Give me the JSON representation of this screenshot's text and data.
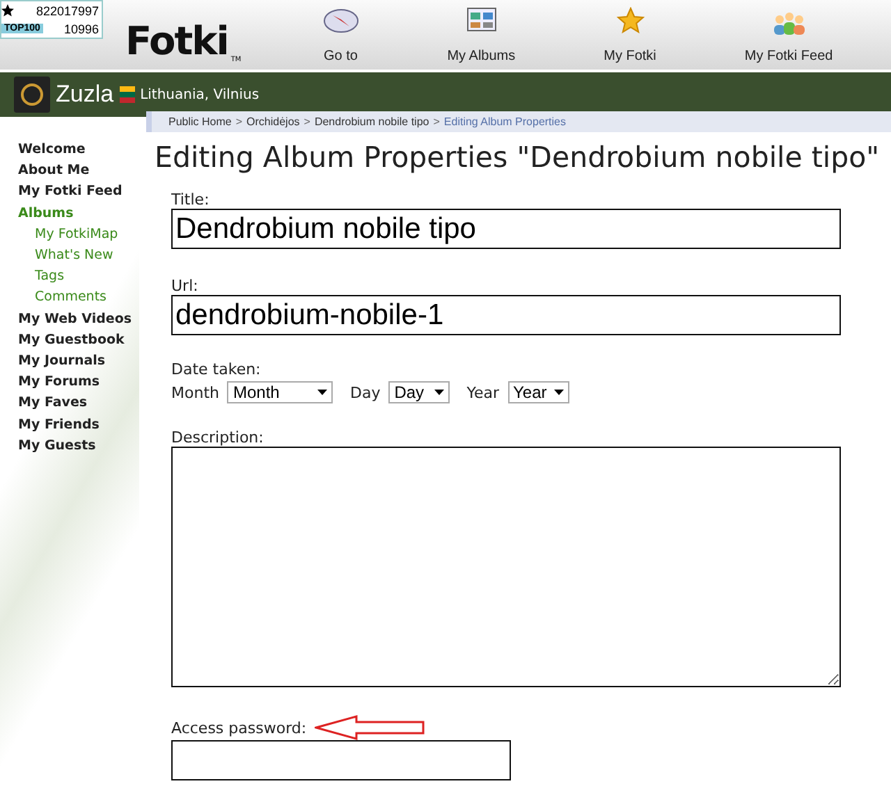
{
  "counter": {
    "hits": "822017997",
    "badge": "TOP100",
    "rank": "10996"
  },
  "logo": {
    "text": "Fotki",
    "tm": "TM"
  },
  "nav": [
    {
      "label": "Go to",
      "kind": "compass"
    },
    {
      "label": "My Albums",
      "kind": "albums"
    },
    {
      "label": "My Fotki",
      "kind": "star"
    },
    {
      "label": "My Fotki Feed",
      "kind": "people"
    }
  ],
  "user": {
    "name": "Zuzla",
    "location": "Lithuania, Vilnius"
  },
  "sidebar": [
    {
      "label": "Welcome",
      "selected": false
    },
    {
      "label": "About Me",
      "selected": false
    },
    {
      "label": "My Fotki Feed",
      "selected": false
    },
    {
      "label": "Albums",
      "selected": true,
      "children": [
        {
          "label": "My FotkiMap"
        },
        {
          "label": "What's New"
        },
        {
          "label": "Tags"
        },
        {
          "label": "Comments"
        }
      ]
    },
    {
      "label": "My Web Videos",
      "selected": false
    },
    {
      "label": "My Guestbook",
      "selected": false
    },
    {
      "label": "My Journals",
      "selected": false
    },
    {
      "label": "My Forums",
      "selected": false
    },
    {
      "label": "My Faves",
      "selected": false
    },
    {
      "label": "My Friends",
      "selected": false
    },
    {
      "label": "My Guests",
      "selected": false
    }
  ],
  "breadcrumb_separator": ">",
  "breadcrumb": [
    {
      "label": "Public Home",
      "current": false
    },
    {
      "label": "Orchidėjos",
      "current": false
    },
    {
      "label": "Dendrobium nobile tipo",
      "current": false
    },
    {
      "label": "Editing Album Properties",
      "current": true
    }
  ],
  "heading": "Editing Album Properties \"Dendrobium nobile tipo\"",
  "form": {
    "title": {
      "label": "Title:",
      "value": "Dendrobium nobile tipo"
    },
    "url": {
      "label": "Url:",
      "value": "dendrobium-nobile-1"
    },
    "date": {
      "label": "Date taken:",
      "parts": [
        {
          "label": "Month",
          "value": "Month"
        },
        {
          "label": "Day",
          "value": "Day"
        },
        {
          "label": "Year",
          "value": "Year"
        }
      ]
    },
    "description": {
      "label": "Description:"
    },
    "password": {
      "label": "Access password:"
    }
  }
}
